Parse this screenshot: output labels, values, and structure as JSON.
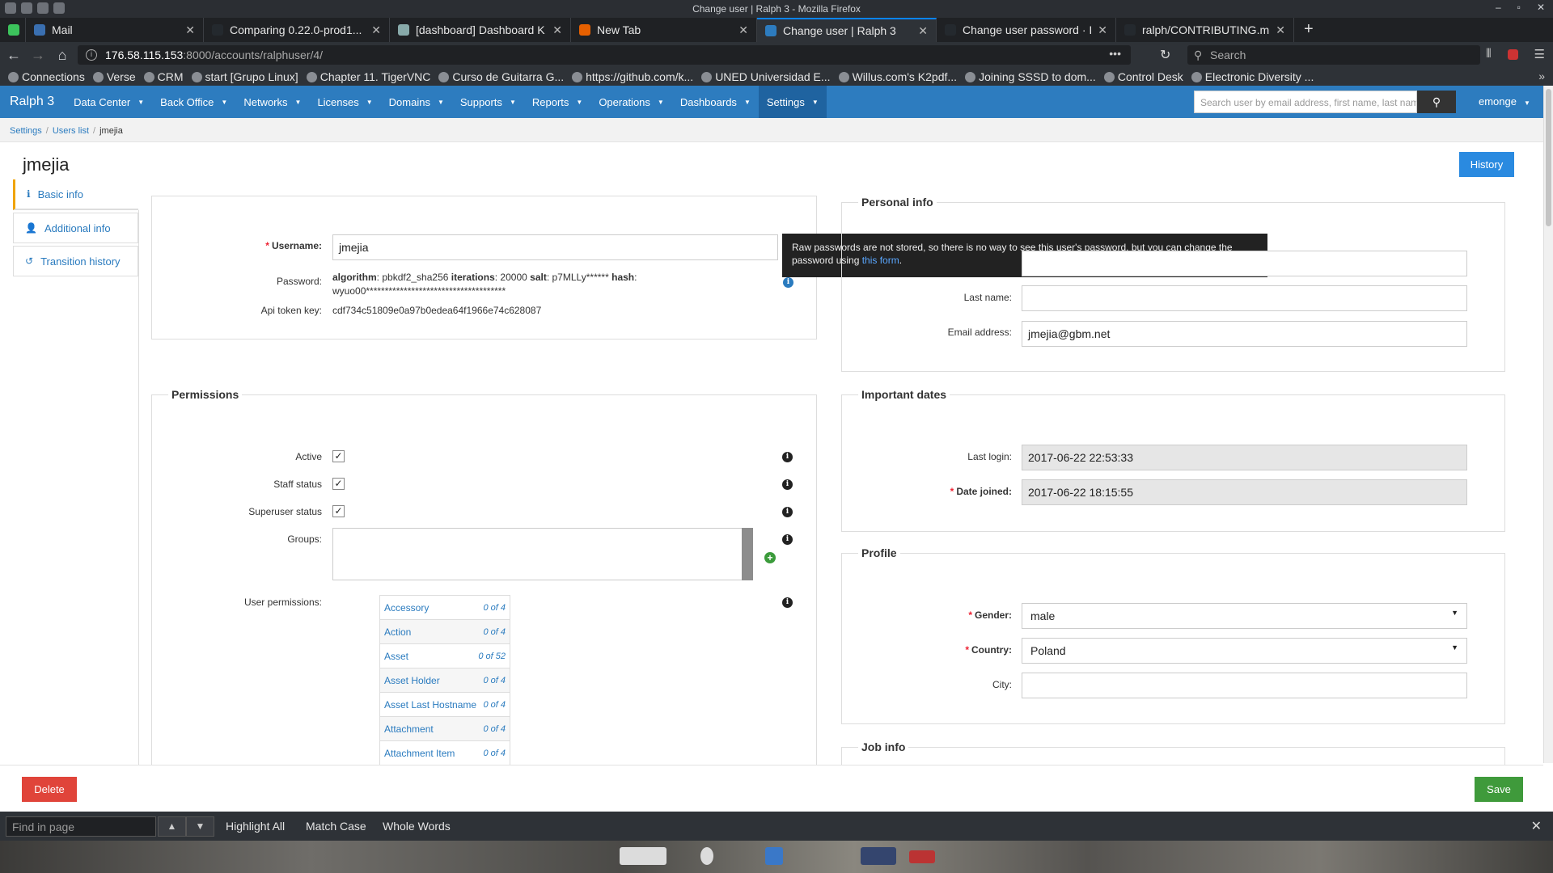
{
  "window": {
    "title": "Change user | Ralph 3 - Mozilla Firefox"
  },
  "tabs": [
    {
      "label": "Mail",
      "active": false
    },
    {
      "label": "Comparing 0.22.0-prod1...",
      "active": false
    },
    {
      "label": "[dashboard] Dashboard K",
      "active": false
    },
    {
      "label": "New Tab",
      "active": false
    },
    {
      "label": "Change user | Ralph 3",
      "active": true
    },
    {
      "label": "Change user password · I",
      "active": false
    },
    {
      "label": "ralph/CONTRIBUTING.md",
      "active": false
    }
  ],
  "url": {
    "host": "176.58.115.153",
    "rest": ":8000/accounts/ralphuser/4/"
  },
  "browser_search": {
    "placeholder": "Search"
  },
  "bookmarks": [
    "Connections",
    "Verse",
    "CRM",
    "start [Grupo Linux]",
    "Chapter 11. TigerVNC",
    "Curso de Guitarra G...",
    "https://github.com/k...",
    "UNED Universidad E...",
    "Willus.com's K2pdf...",
    "Joining SSSD to dom...",
    "Control Desk",
    "Electronic Diversity ..."
  ],
  "app": {
    "brand": "Ralph 3",
    "menu": [
      "Data Center",
      "Back Office",
      "Networks",
      "Licenses",
      "Domains",
      "Supports",
      "Reports",
      "Operations",
      "Dashboards",
      "Settings"
    ],
    "active_menu": "Settings",
    "user_search_placeholder": "Search user by email address, first name, last name",
    "username": "emonge"
  },
  "breadcrumbs": [
    "Settings",
    "Users list",
    "jmejia"
  ],
  "page": {
    "title": "jmejia",
    "history_label": "History"
  },
  "sidenav": [
    {
      "label": "Basic info",
      "icon": "info-icon"
    },
    {
      "label": "Additional info",
      "icon": "user-icon"
    },
    {
      "label": "Transition history",
      "icon": "history-icon"
    }
  ],
  "basic": {
    "username_label": "Username:",
    "username_value": "jmejia",
    "password_label": "Password:",
    "password_line1_parts": [
      "algorithm",
      ": pbkdf2_sha256 ",
      "iterations",
      ": 20000 ",
      "salt",
      ": p7MLLy****** ",
      "hash",
      ":"
    ],
    "password_line2": "wyuo00*************************************",
    "api_label": "Api token key:",
    "api_value": "cdf734c51809e0a97b0edea64f1966e74c628087"
  },
  "tooltip": {
    "text": "Raw passwords are not stored, so there is no way to see this user's password, but you can change the password using ",
    "link": "this form",
    "end": "."
  },
  "permissions": {
    "legend": "Permissions",
    "active_label": "Active",
    "staff_label": "Staff status",
    "superuser_label": "Superuser status",
    "groups_label": "Groups:",
    "user_perms_label": "User permissions:",
    "rows": [
      {
        "name": "Accessory",
        "count": "0 of 4"
      },
      {
        "name": "Action",
        "count": "0 of 4"
      },
      {
        "name": "Asset",
        "count": "0 of 52"
      },
      {
        "name": "Asset Holder",
        "count": "0 of 4"
      },
      {
        "name": "Asset Last Hostname",
        "count": "0 of 4"
      },
      {
        "name": "Attachment",
        "count": "0 of 4"
      },
      {
        "name": "Attachment Item",
        "count": "0 of 4"
      }
    ]
  },
  "personal": {
    "legend": "Personal info",
    "last_name_label": "Last name:",
    "last_name_value": "",
    "email_label": "Email address:",
    "email_value": "jmejia@gbm.net"
  },
  "dates": {
    "legend": "Important dates",
    "last_login_label": "Last login:",
    "last_login_value": "2017-06-22 22:53:33",
    "date_joined_label": "Date joined:",
    "date_joined_value": "2017-06-22 18:15:55"
  },
  "profile": {
    "legend": "Profile",
    "gender_label": "Gender:",
    "gender_value": "male",
    "country_label": "Country:",
    "country_value": "Poland",
    "city_label": "City:",
    "city_value": ""
  },
  "job": {
    "legend": "Job info"
  },
  "footer": {
    "delete_label": "Delete",
    "save_label": "Save"
  },
  "findbar": {
    "placeholder": "Find in page",
    "highlight": "Highlight All",
    "match_case": "Match Case",
    "whole_words": "Whole Words"
  },
  "colors": {
    "accent": "#2d7cbf",
    "delete": "#e0443a",
    "save": "#3f9a3b",
    "history": "#2a8ae0"
  }
}
